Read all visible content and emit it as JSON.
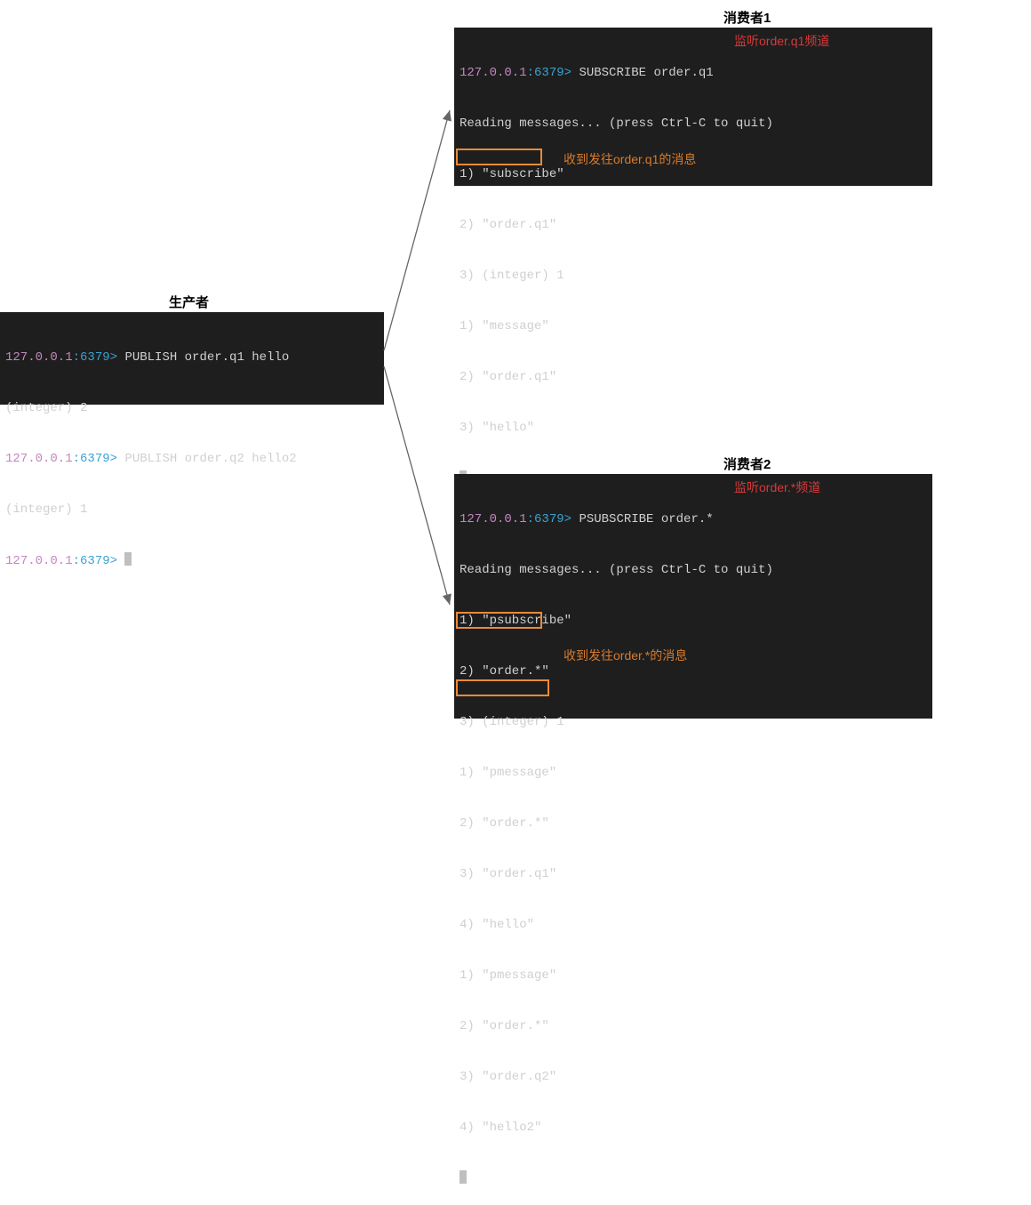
{
  "colors": {
    "accent": "#e88b3a",
    "ip": "#c586c0",
    "port": "#3ba3d0",
    "ann_red": "#d63939",
    "ann_orange": "#d97b2b"
  },
  "producer": {
    "title": "生产者",
    "lines": [
      {
        "prompt_ip": "127.0.0.1",
        "prompt_port": ":6379> ",
        "cmd": "PUBLISH order.q1 hello"
      },
      {
        "txt": "(integer) 2"
      },
      {
        "prompt_ip": "127.0.0.1",
        "prompt_port": ":6379> ",
        "cmd": "PUBLISH order.q2 hello2"
      },
      {
        "txt": "(integer) 1"
      },
      {
        "prompt_ip": "127.0.0.1",
        "prompt_port": ":6379> ",
        "caret": true
      }
    ]
  },
  "consumer1": {
    "title": "消费者1",
    "lines": [
      {
        "prompt_ip": "127.0.0.1",
        "prompt_port": ":6379> ",
        "cmd": "SUBSCRIBE order.q1"
      },
      {
        "txt": "Reading messages... (press Ctrl-C to quit)"
      },
      {
        "txt": "1) \"subscribe\""
      },
      {
        "txt": "2) \"order.q1\""
      },
      {
        "txt": "3) (integer) 1"
      },
      {
        "txt": "1) \"message\""
      },
      {
        "txt": "2) \"order.q1\""
      },
      {
        "txt": "3) \"hello\""
      }
    ],
    "ann_cmd": "监听order.q1频道",
    "ann_msg": "收到发往order.q1的消息"
  },
  "consumer2": {
    "title": "消费者2",
    "lines": [
      {
        "prompt_ip": "127.0.0.1",
        "prompt_port": ":6379> ",
        "cmd": "PSUBSCRIBE order.*"
      },
      {
        "txt": "Reading messages... (press Ctrl-C to quit)"
      },
      {
        "txt": "1) \"psubscribe\""
      },
      {
        "txt": "2) \"order.*\""
      },
      {
        "txt": "3) (integer) 1"
      },
      {
        "txt": "1) \"pmessage\""
      },
      {
        "txt": "2) \"order.*\""
      },
      {
        "txt": "3) \"order.q1\""
      },
      {
        "txt": "4) \"hello\""
      },
      {
        "txt": "1) \"pmessage\""
      },
      {
        "txt": "2) \"order.*\""
      },
      {
        "txt": "3) \"order.q2\""
      },
      {
        "txt": "4) \"hello2\""
      }
    ],
    "ann_cmd": "监听order.*频道",
    "ann_msg": "收到发往order.*的消息"
  }
}
